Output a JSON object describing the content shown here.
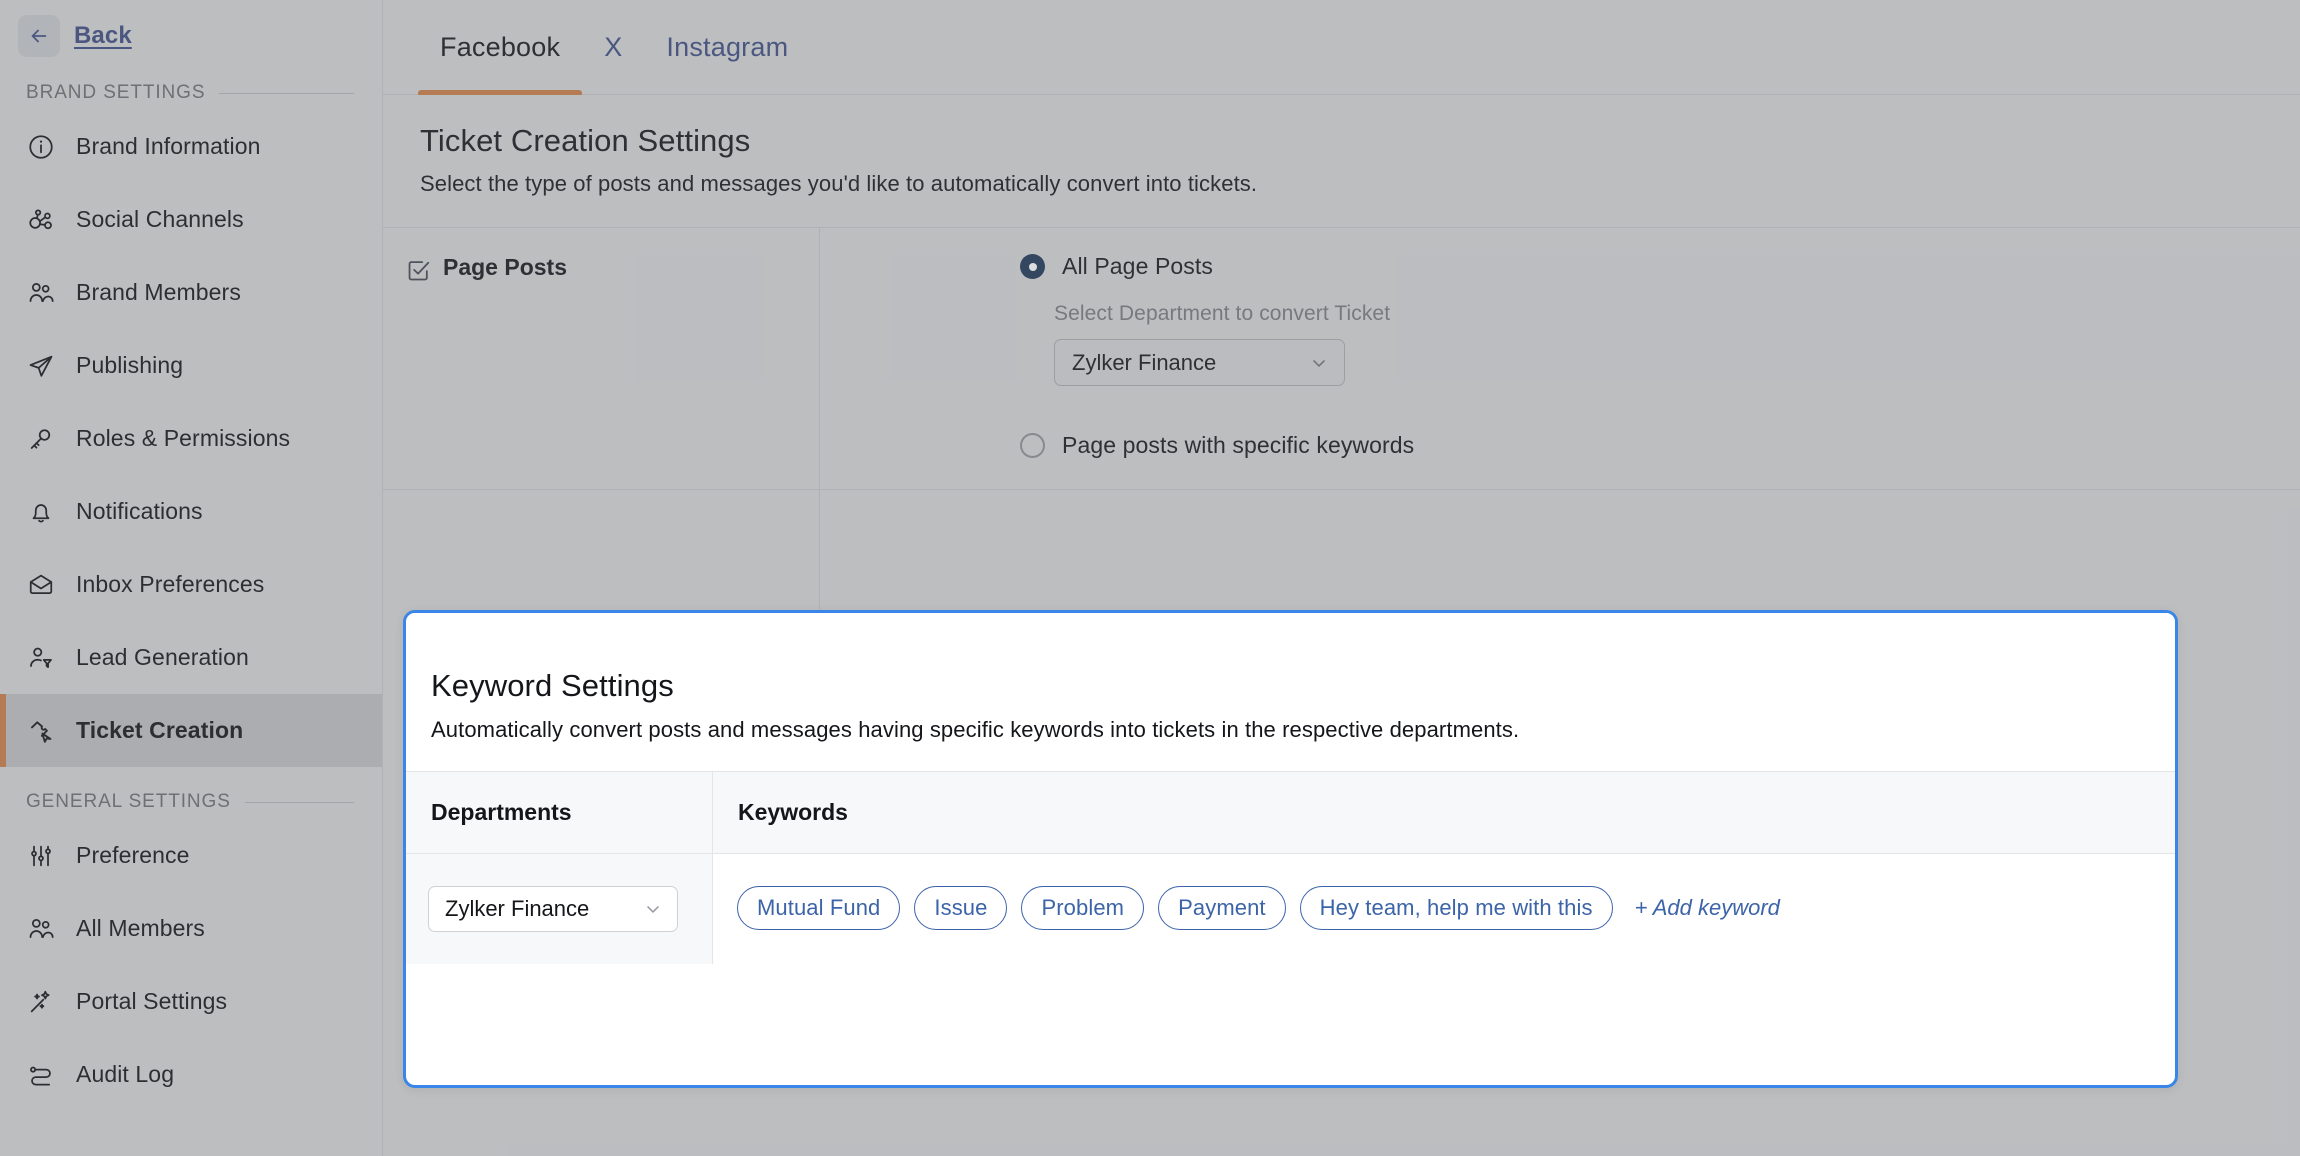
{
  "sidebar": {
    "back_label": "Back",
    "groups": [
      {
        "title": "BRAND SETTINGS",
        "items": [
          {
            "label": "Brand Information",
            "icon": "info-circle-icon",
            "active": false
          },
          {
            "label": "Social Channels",
            "icon": "social-channels-icon",
            "active": false
          },
          {
            "label": "Brand Members",
            "icon": "users-icon",
            "active": false
          },
          {
            "label": "Publishing",
            "icon": "paper-plane-icon",
            "active": false
          },
          {
            "label": "Roles & Permissions",
            "icon": "key-icon",
            "active": false
          },
          {
            "label": "Notifications",
            "icon": "bell-icon",
            "active": false
          },
          {
            "label": "Inbox Preferences",
            "icon": "envelope-open-icon",
            "active": false
          },
          {
            "label": "Lead Generation",
            "icon": "user-funnel-icon",
            "active": false
          },
          {
            "label": "Ticket Creation",
            "icon": "ticket-cursor-icon",
            "active": true
          }
        ]
      },
      {
        "title": "GENERAL SETTINGS",
        "items": [
          {
            "label": "Preference",
            "icon": "sliders-icon",
            "active": false
          },
          {
            "label": "All Members",
            "icon": "users-icon",
            "active": false
          },
          {
            "label": "Portal Settings",
            "icon": "magic-wand-icon",
            "active": false
          },
          {
            "label": "Audit Log",
            "icon": "audit-log-icon",
            "active": false
          }
        ]
      }
    ]
  },
  "tabs": [
    {
      "label": "Facebook",
      "active": true
    },
    {
      "label": "X",
      "active": false
    },
    {
      "label": "Instagram",
      "active": false
    }
  ],
  "page": {
    "title": "Ticket Creation Settings",
    "subtitle": "Select the type of posts and messages you'd like to automatically convert into tickets."
  },
  "page_posts": {
    "checkbox_label": "Page Posts",
    "checkbox_checked": true,
    "options": [
      {
        "label": "All Page Posts",
        "selected": true
      },
      {
        "label": "Page posts with specific keywords",
        "selected": false
      }
    ],
    "department_caption": "Select Department to convert Ticket",
    "department_value": "Zylker Finance"
  },
  "keyword_card": {
    "title": "Keyword Settings",
    "description": "Automatically convert posts and messages having specific keywords into tickets in the respective departments.",
    "columns": {
      "departments": "Departments",
      "keywords": "Keywords"
    },
    "rows": [
      {
        "department": "Zylker Finance",
        "keywords": [
          "Mutual Fund",
          "Issue",
          "Problem",
          "Payment",
          "Hey team, help me with this"
        ],
        "add_label": "+ Add keyword"
      }
    ]
  },
  "colors": {
    "accent_orange": "#c97b45",
    "highlight_blue": "#3a86e8",
    "link_blue": "#3c4b82",
    "chip_blue": "#3c64a8",
    "radio_selected": "#1d3557",
    "sidebar_bg": "#d4d5d7",
    "active_item_bg": "#bdbec1"
  }
}
